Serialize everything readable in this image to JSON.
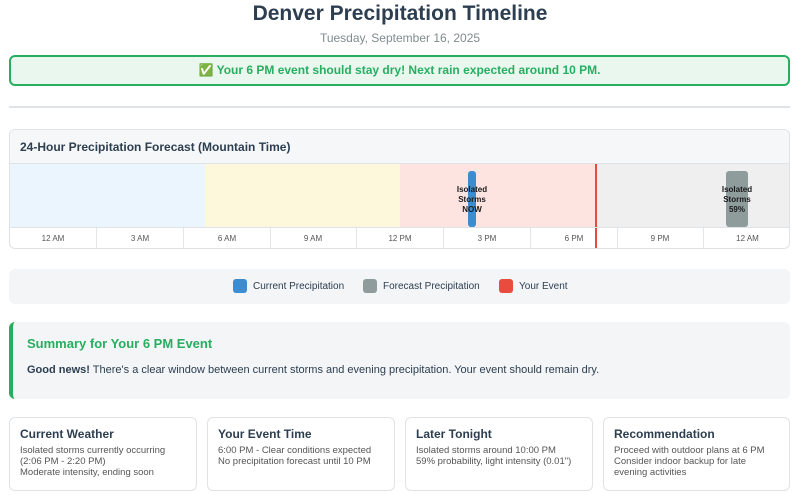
{
  "header": {
    "title": "Denver Precipitation Timeline",
    "date": "Tuesday, September 16, 2025"
  },
  "banner": {
    "icon": "check-mark-icon",
    "icon_glyph": "✅",
    "text": "Your 6 PM event should stay dry! Next rain expected around 10 PM."
  },
  "timeline": {
    "title": "24-Hour Precipitation Forecast (Mountain Time)",
    "ticks": [
      "12 AM",
      "3 AM",
      "6 AM",
      "9 AM",
      "12 PM",
      "3 PM",
      "6 PM",
      "9 PM",
      "12 AM"
    ],
    "current_precip": {
      "line1": "Isolated",
      "line2": "Storms",
      "line3": "NOW"
    },
    "forecast_precip": {
      "line1": "Isolated",
      "line2": "Storms",
      "line3": "59%"
    }
  },
  "legend": {
    "items": [
      {
        "label": "Current Precipitation",
        "color": "#3b8dd0"
      },
      {
        "label": "Forecast Precipitation",
        "color": "#8e9c9c"
      },
      {
        "label": "Your Event",
        "color": "#e74c3c"
      }
    ]
  },
  "summary": {
    "title": "Summary for Your 6 PM Event",
    "lead": "Good news!",
    "text": " There's a clear window between current storms and evening precipitation. Your event should remain dry."
  },
  "cards": [
    {
      "title": "Current Weather",
      "lines": [
        "Isolated storms currently occurring",
        "(2:06 PM - 2:20 PM)",
        "Moderate intensity, ending soon"
      ]
    },
    {
      "title": "Your Event Time",
      "lines": [
        "6:00 PM - Clear conditions expected",
        "No precipitation forecast until 10 PM"
      ]
    },
    {
      "title": "Later Tonight",
      "lines": [
        "Isolated storms around 10:00 PM",
        "59% probability, light intensity (0.01\")"
      ]
    },
    {
      "title": "Recommendation",
      "lines": [
        "Proceed with outdoor plans at 6 PM",
        "Consider indoor backup for late",
        "evening activities"
      ]
    }
  ],
  "colors": {
    "accent_green": "#27ae60",
    "event_red": "#e74c3c",
    "current_blue": "#3b8dd0",
    "forecast_gray": "#8e9c9c"
  }
}
